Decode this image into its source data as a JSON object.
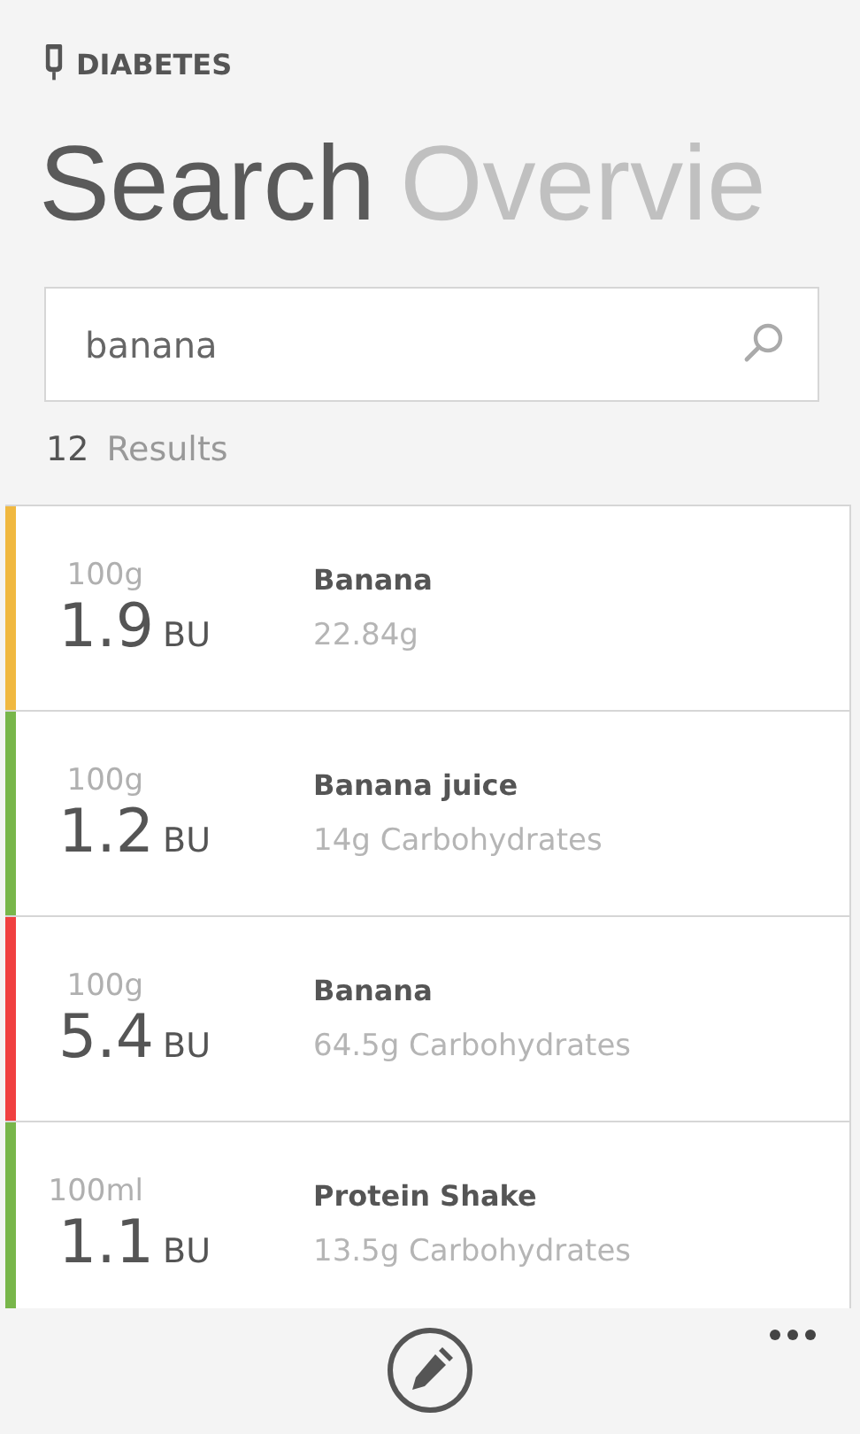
{
  "app_title": "DIABETES",
  "pivot": [
    {
      "label": "Search",
      "selected": true
    },
    {
      "label": "Overvie",
      "selected": false
    }
  ],
  "search": {
    "value": "banana"
  },
  "results": {
    "count": "12",
    "label": "Results"
  },
  "items": [
    {
      "amount": "100g",
      "bu": "1.9",
      "unit": "BU",
      "name": "Banana",
      "detail": "22.84g",
      "color": "#f0b840"
    },
    {
      "amount": "100g",
      "bu": "1.2",
      "unit": "BU",
      "name": "Banana juice",
      "detail": "14g Carbohydrates",
      "color": "#78b64a"
    },
    {
      "amount": "100g",
      "bu": "5.4",
      "unit": "BU",
      "name": "Banana",
      "detail": "64.5g Carbohydrates",
      "color": "#f04040"
    },
    {
      "amount": "100ml",
      "bu": "1.1",
      "unit": "BU",
      "name": "Protein Shake",
      "detail": "13.5g Carbohydrates",
      "color": "#78b64a"
    }
  ]
}
